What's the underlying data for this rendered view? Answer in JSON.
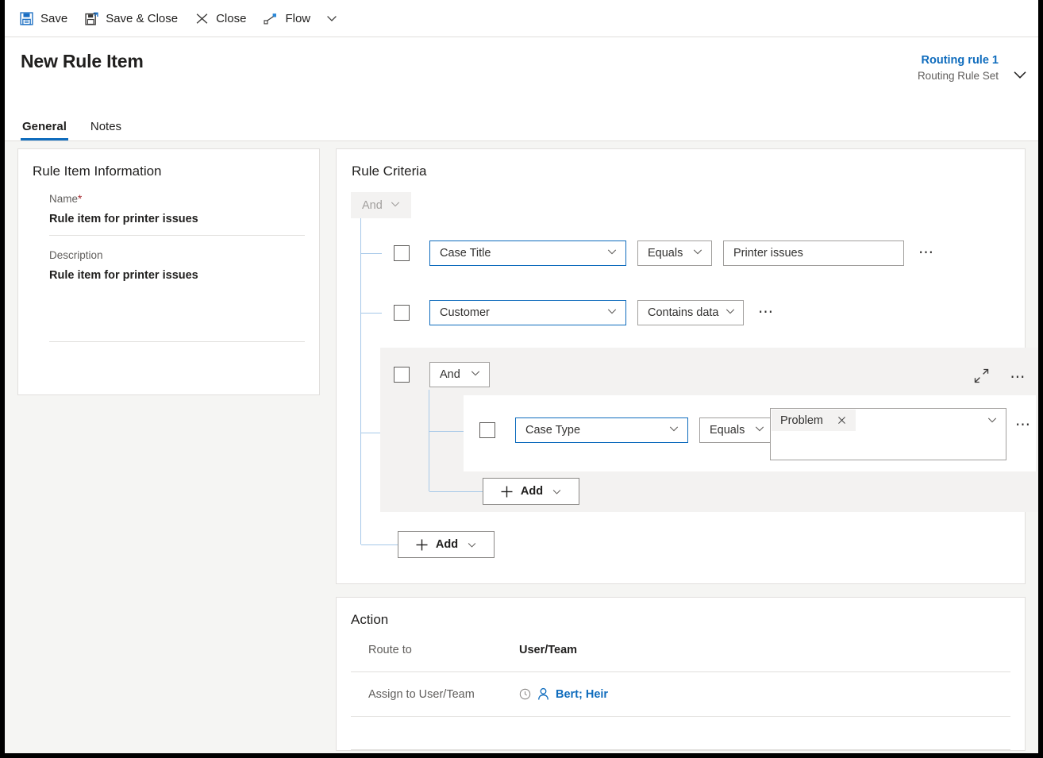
{
  "commandbar": {
    "items": [
      {
        "label": "Save",
        "icon": "save-icon"
      },
      {
        "label": "Save & Close",
        "icon": "save-and-close-icon"
      },
      {
        "label": "Close",
        "icon": "close-x-icon"
      },
      {
        "label": "Flow",
        "icon": "flow-icon"
      }
    ]
  },
  "header": {
    "title": "New Rule Item",
    "record": {
      "name": "Routing rule 1",
      "subtitle": "Routing Rule Set"
    },
    "tabs": [
      {
        "label": "General",
        "active": true
      },
      {
        "label": "Notes",
        "active": false
      }
    ]
  },
  "rule_item_information": {
    "section_title": "Rule Item Information",
    "name": {
      "label": "Name",
      "required_marker": "*",
      "value": "Rule item for printer issues"
    },
    "description": {
      "label": "Description",
      "value": "Rule item for printer issues"
    }
  },
  "rule_criteria": {
    "section_title": "Rule Criteria",
    "root_operator": {
      "label": "And",
      "disabled": true
    },
    "conditions": [
      {
        "attribute": "Case Title",
        "operator": "Equals",
        "value": "Printer issues",
        "has_value_field": true
      },
      {
        "attribute": "Customer",
        "operator": "Contains data",
        "value": "",
        "has_value_field": false
      }
    ],
    "group": {
      "operator": "And",
      "collapse_icon": "collapse-icon",
      "more_icon": "more-ellipsis-icon",
      "conditions": [
        {
          "attribute": "Case Type",
          "operator": "Equals",
          "tags": [
            "Problem"
          ]
        }
      ],
      "add_button": {
        "label": "Add",
        "icon": "plus-icon"
      }
    },
    "add_button": {
      "label": "Add",
      "icon": "plus-icon"
    }
  },
  "action": {
    "section_title": "Action",
    "route_to": {
      "label": "Route to",
      "value": "User/Team"
    },
    "assign_to": {
      "label": "Assign to User/Team",
      "value": "Bert; Heir",
      "icon": "user-icon"
    }
  },
  "colors": {
    "accent": "#0f6cbd",
    "required": "#a4262c",
    "tree_line": "#a6c8e8",
    "group_bg": "#f3f2f1",
    "page_bg": "#f5f5f3"
  }
}
